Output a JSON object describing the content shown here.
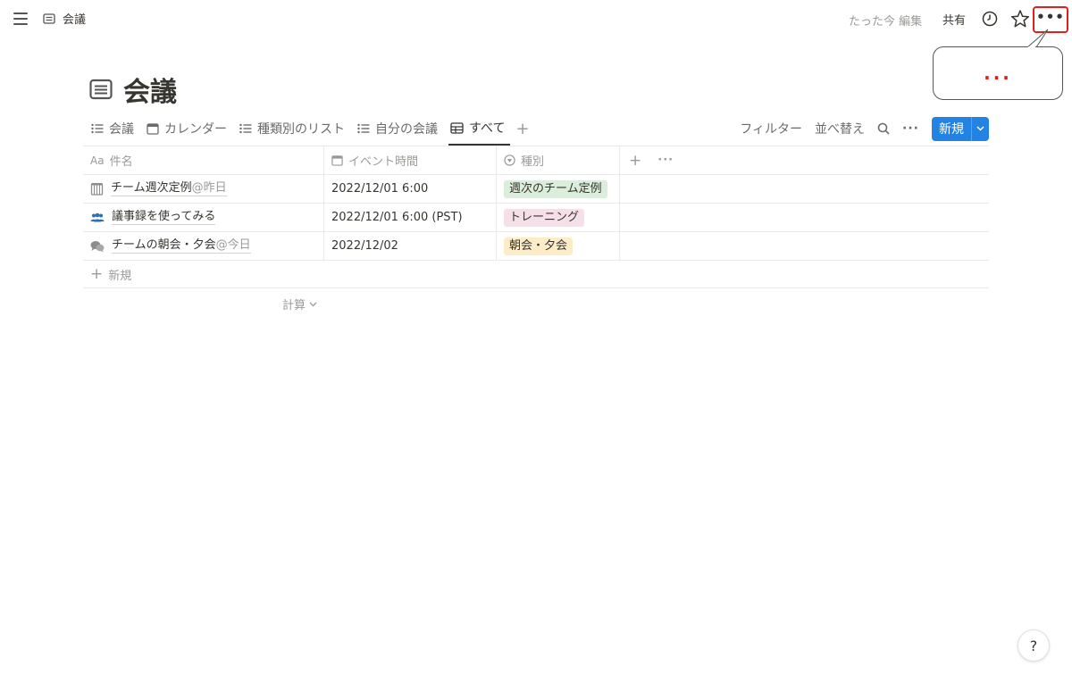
{
  "breadcrumb": {
    "title": "会議",
    "icon": "document-icon"
  },
  "topbar": {
    "edited": "たった今 編集",
    "share_label": "共有",
    "more_label": "•••"
  },
  "callout": {
    "text": "..."
  },
  "page": {
    "title": "会議",
    "icon": "document-icon"
  },
  "tabs": [
    {
      "label": "会議",
      "icon": "list-icon"
    },
    {
      "label": "カレンダー",
      "icon": "calendar-icon"
    },
    {
      "label": "種類別のリスト",
      "icon": "list-icon"
    },
    {
      "label": "自分の会議",
      "icon": "list-icon"
    },
    {
      "label": "すべて",
      "icon": "table-icon",
      "active": true
    }
  ],
  "toolbar": {
    "filter_label": "フィルター",
    "sort_label": "並べ替え",
    "new_label": "新規"
  },
  "table": {
    "columns": [
      {
        "label": "件名",
        "prefix": "Aa"
      },
      {
        "label": "イベント時間"
      },
      {
        "label": "種別"
      }
    ],
    "rows": [
      {
        "name": "チーム週次定例",
        "mention": "@昨日",
        "time": "2022/12/01 6:00",
        "tag": "週次のチーム定例",
        "tag_bg": "#dbeddb",
        "icon": "calendar-grid-icon"
      },
      {
        "name": "議事録を使ってみる",
        "mention": "",
        "time": "2022/12/01 6:00 (PST)",
        "tag": "トレーニング",
        "tag_bg": "#f5e0e9",
        "icon": "people-icon"
      },
      {
        "name": "チームの朝会・夕会",
        "mention": "@今日",
        "time": "2022/12/02",
        "tag": "朝会・夕会",
        "tag_bg": "#fdecc8",
        "icon": "chat-bubbles-icon"
      }
    ],
    "add_row_label": "新規",
    "calc_label": "計算"
  },
  "help_label": "?",
  "colors": {
    "accent": "#2383e2",
    "highlight": "#e0201a"
  }
}
